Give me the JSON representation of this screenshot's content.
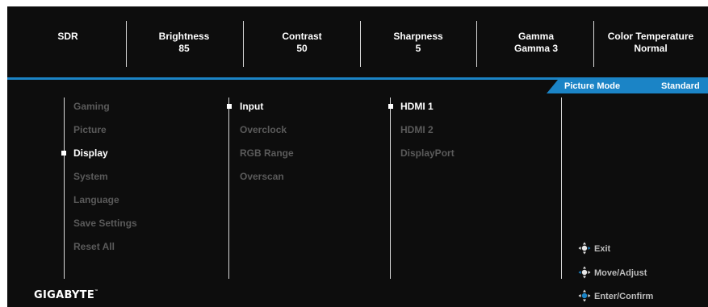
{
  "status_bar": {
    "items": [
      {
        "label": "SDR",
        "value": ""
      },
      {
        "label": "Brightness",
        "value": "85"
      },
      {
        "label": "Contrast",
        "value": "50"
      },
      {
        "label": "Sharpness",
        "value": "5"
      },
      {
        "label": "Gamma",
        "value": "Gamma 3"
      },
      {
        "label": "Color Temperature",
        "value": "Normal"
      }
    ]
  },
  "picture_mode": {
    "label": "Picture Mode",
    "value": "Standard"
  },
  "main_menu": {
    "items": [
      "Gaming",
      "Picture",
      "Display",
      "System",
      "Language",
      "Save Settings",
      "Reset All"
    ],
    "selected": "Display"
  },
  "display_menu": {
    "items": [
      "Input",
      "Overclock",
      "RGB Range",
      "Overscan"
    ],
    "selected": "Input"
  },
  "input_menu": {
    "items": [
      "HDMI 1",
      "HDMI 2",
      "DisplayPort"
    ],
    "selected": "HDMI 1"
  },
  "help": {
    "exit": "Exit",
    "move": "Move/Adjust",
    "enter": "Enter/Confirm"
  },
  "brand": "GIGABYTE",
  "colors": {
    "accent": "#1b84c6",
    "inactive_text": "#5a5a5a",
    "background": "#0d0d0d"
  }
}
